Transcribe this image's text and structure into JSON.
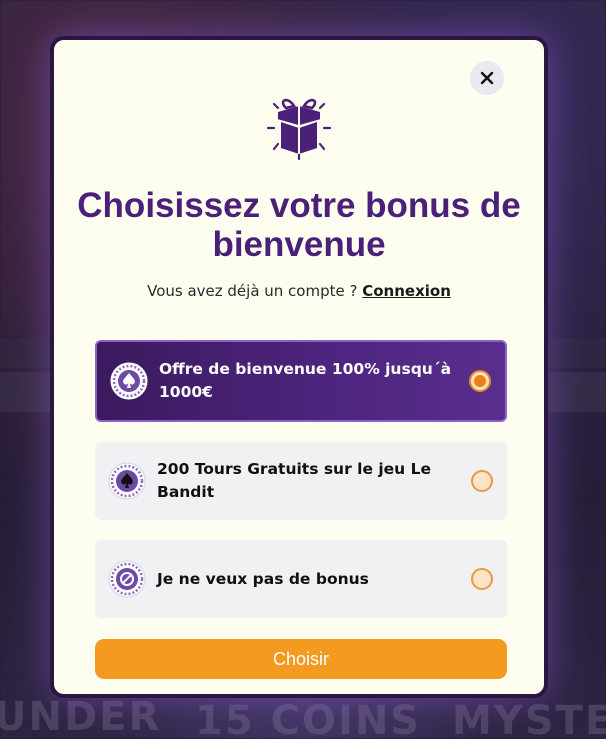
{
  "background": {
    "words": [
      "UNDER",
      "15 COINS",
      "MYSTER"
    ]
  },
  "modal": {
    "close_icon": "close-icon",
    "gift_icon": "gift-box-icon",
    "title": "Choisissez votre bonus de bienvenue",
    "subtitle_text": "Vous avez déjà un compte ?",
    "login_link": "Connexion",
    "options": [
      {
        "label": "Offre de bienvenue 100% jusqu´à 1000€",
        "icon": "spade-badge-icon",
        "selected": true
      },
      {
        "label": "200 Tours Gratuits sur le jeu Le Bandit",
        "icon": "spade-badge-icon",
        "selected": false
      },
      {
        "label": "Je ne veux pas de bonus",
        "icon": "no-bonus-badge-icon",
        "selected": false
      }
    ],
    "submit_label": "Choisir"
  },
  "colors": {
    "title": "#4b2079",
    "selected_option_bg": "#4e2580",
    "accent_orange": "#f59a20",
    "modal_bg": "#fdfdf0"
  }
}
